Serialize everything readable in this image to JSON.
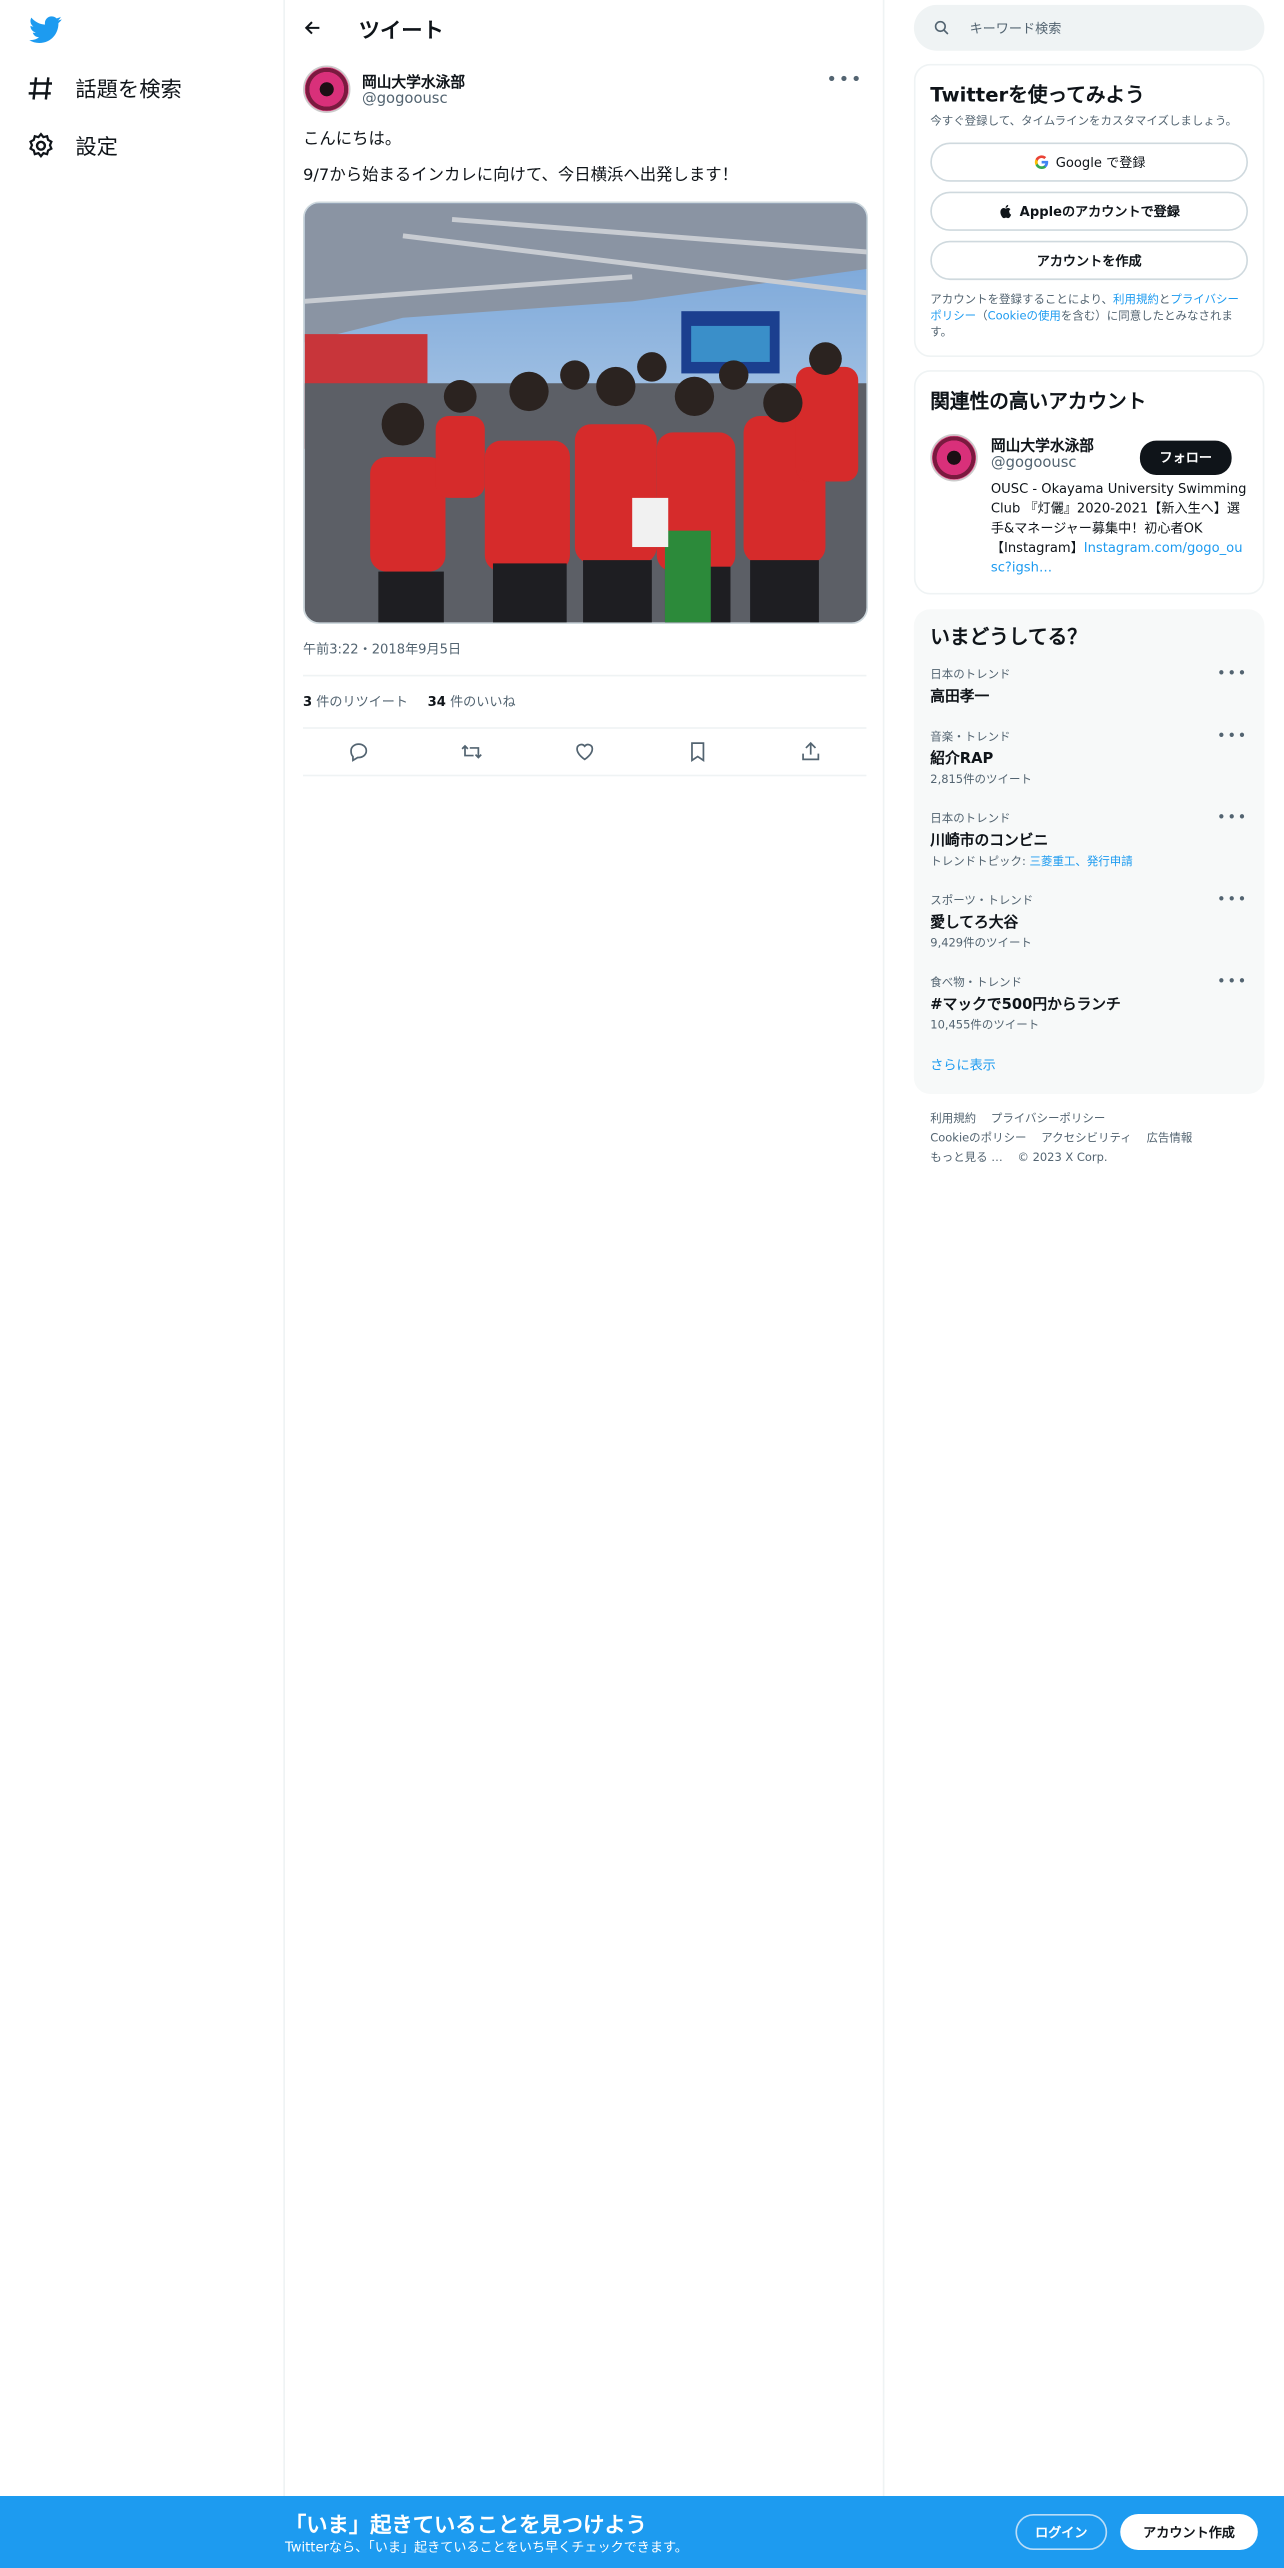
{
  "nav": {
    "explore_label": "話題を検索",
    "settings_label": "設定"
  },
  "header": {
    "title": "ツイート"
  },
  "tweet": {
    "author_name": "岡山大学水泳部",
    "author_handle": "@gogoousc",
    "text_line1": "こんにちは。",
    "text_line2": "9/7から始まるインカレに向けて、今日横浜へ出発します！",
    "timestamp": "午前3:22・2018年9月5日",
    "retweet_count": "3",
    "retweet_label": " 件のリツイート",
    "like_count": "34",
    "like_label": " 件のいいね"
  },
  "search": {
    "placeholder": "キーワード検索"
  },
  "signup": {
    "title": "Twitterを使ってみよう",
    "subtitle": "今すぐ登録して、タイムラインをカスタマイズしましょう。",
    "google_label": "Google で登録",
    "apple_label": "Appleのアカウントで登録",
    "create_label": "アカウントを作成",
    "legal_prefix": "アカウントを登録することにより、",
    "legal_terms": "利用規約",
    "legal_and": "と",
    "legal_privacy": "プライバシーポリシー",
    "legal_open": "（",
    "legal_cookie": "Cookieの使用",
    "legal_suffix": "を含む）に同意したとみなされます。"
  },
  "related": {
    "title": "関連性の高いアカウント",
    "name": "岡山大学水泳部",
    "handle": "@gogoousc",
    "follow_label": "フォロー",
    "bio": "OUSC - Okayama University Swimming Club 『灯儷』2020-2021【新入生へ】選手&マネージャー募集中！初心者OK 【Instagram】",
    "bio_link": "Instagram.com/gogo_ousc?igsh…"
  },
  "trends": {
    "title": "いまどうしてる？",
    "items": [
      {
        "context": "日本のトレンド",
        "name": "高田孝一",
        "count": ""
      },
      {
        "context": "音楽・トレンド",
        "name": "紹介RAP",
        "count": "2,815件のツイート"
      },
      {
        "context": "日本のトレンド",
        "name": "川崎市のコンビニ",
        "count": "トレンドトピック: ",
        "topics": "三菱重工、発行申請"
      },
      {
        "context": "スポーツ・トレンド",
        "name": "愛してろ大谷",
        "count": "9,429件のツイート"
      },
      {
        "context": "食べ物・トレンド",
        "name": "#マックで500円からランチ",
        "count": "10,455件のツイート"
      }
    ],
    "show_more": "さらに表示"
  },
  "footer": {
    "links": [
      "利用規約",
      "プライバシーポリシー",
      "Cookieのポリシー",
      "アクセシビリティ",
      "広告情報",
      "もっと見る …"
    ],
    "copyright": "© 2023 X Corp."
  },
  "banner": {
    "title": "「いま」起きていることを見つけよう",
    "subtitle": "Twitterなら、「いま」起きていることをいち早くチェックできます。",
    "login_label": "ログイン",
    "signup_label": "アカウント作成"
  },
  "colors": {
    "brand": "#1d9bf0",
    "text": "#0f1419",
    "muted": "#536471"
  }
}
